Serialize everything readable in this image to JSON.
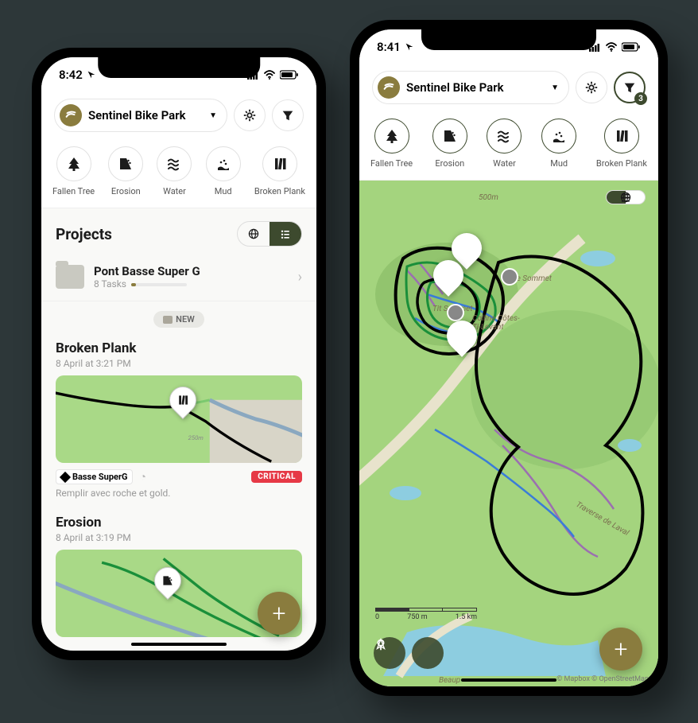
{
  "phone_left": {
    "status": {
      "time": "8:42"
    },
    "park_name": "Sentinel Bike Park",
    "filters": [
      {
        "label": "Fallen Tree"
      },
      {
        "label": "Erosion"
      },
      {
        "label": "Water"
      },
      {
        "label": "Mud"
      },
      {
        "label": "Broken Plank"
      }
    ],
    "projects_title": "Projects",
    "project": {
      "name": "Pont Basse Super G",
      "tasks": "8 Tasks"
    },
    "new_chip": "NEW",
    "cards": [
      {
        "title": "Broken Plank",
        "ts": "8 April at 3:21 PM",
        "trail": "Basse SuperG",
        "severity": "CRITICAL",
        "note": "Remplir avec roche et gold."
      },
      {
        "title": "Erosion",
        "ts": "8 April at 3:19 PM"
      }
    ]
  },
  "phone_right": {
    "status": {
      "time": "8:41"
    },
    "park_name": "Sentinel Bike Park",
    "filter_badge": "3",
    "filters": [
      {
        "label": "Fallen Tree"
      },
      {
        "label": "Erosion"
      },
      {
        "label": "Water"
      },
      {
        "label": "Mud"
      },
      {
        "label": "Broken Plank"
      }
    ],
    "map_labels": {
      "sommet1": "Ze Sommet",
      "sommet2": "Tit Sommet",
      "colline": "Colline Côtes-Ti-Levant",
      "road": "Traverse de Laval",
      "alt": "500m",
      "beaup": "Beaup"
    },
    "scale": {
      "a": "0",
      "b": "750 m",
      "c": "1.5 km"
    },
    "attrib": "© Mapbox © OpenStreetMap"
  }
}
